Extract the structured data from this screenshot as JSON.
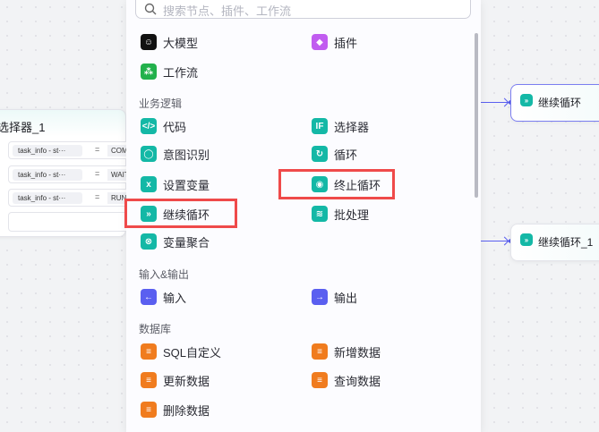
{
  "search": {
    "placeholder": "搜索节点、插件、工作流"
  },
  "canvas": {
    "selector_node": {
      "title": "选择器_1",
      "conditions": [
        {
          "var": "task_info - st···",
          "op": "=",
          "value": "COMP"
        },
        {
          "var": "task_info - st···",
          "op": "=",
          "value": "WAITI"
        },
        {
          "var": "task_info - st···",
          "op": "=",
          "value": "RUNN"
        }
      ]
    },
    "continue_nodes": [
      {
        "label": "继续循环"
      },
      {
        "label": "继续循环_1"
      }
    ]
  },
  "colors": {
    "teal": "#14b8a6",
    "orange": "#f07c1e",
    "blue": "#5a5ff0",
    "purple": "#c15cf0",
    "green": "#22b14c",
    "highlight": "#ef4a4a"
  },
  "menu": {
    "top": [
      {
        "label": "大模型",
        "icon": "llm-icon"
      },
      {
        "label": "插件",
        "icon": "plugin-icon"
      },
      {
        "label": "工作流",
        "icon": "workflow-icon"
      }
    ],
    "sections": [
      {
        "title": "业务逻辑",
        "items": [
          {
            "label": "代码"
          },
          {
            "label": "选择器"
          },
          {
            "label": "意图识别"
          },
          {
            "label": "循环"
          },
          {
            "label": "设置变量"
          },
          {
            "label": "终止循环"
          },
          {
            "label": "继续循环"
          },
          {
            "label": "批处理"
          },
          {
            "label": "变量聚合"
          }
        ]
      },
      {
        "title": "输入&输出",
        "items": [
          {
            "label": "输入"
          },
          {
            "label": "输出"
          }
        ]
      },
      {
        "title": "数据库",
        "items": [
          {
            "label": "SQL自定义"
          },
          {
            "label": "新增数据"
          },
          {
            "label": "更新数据"
          },
          {
            "label": "查询数据"
          },
          {
            "label": "删除数据"
          }
        ]
      }
    ]
  }
}
